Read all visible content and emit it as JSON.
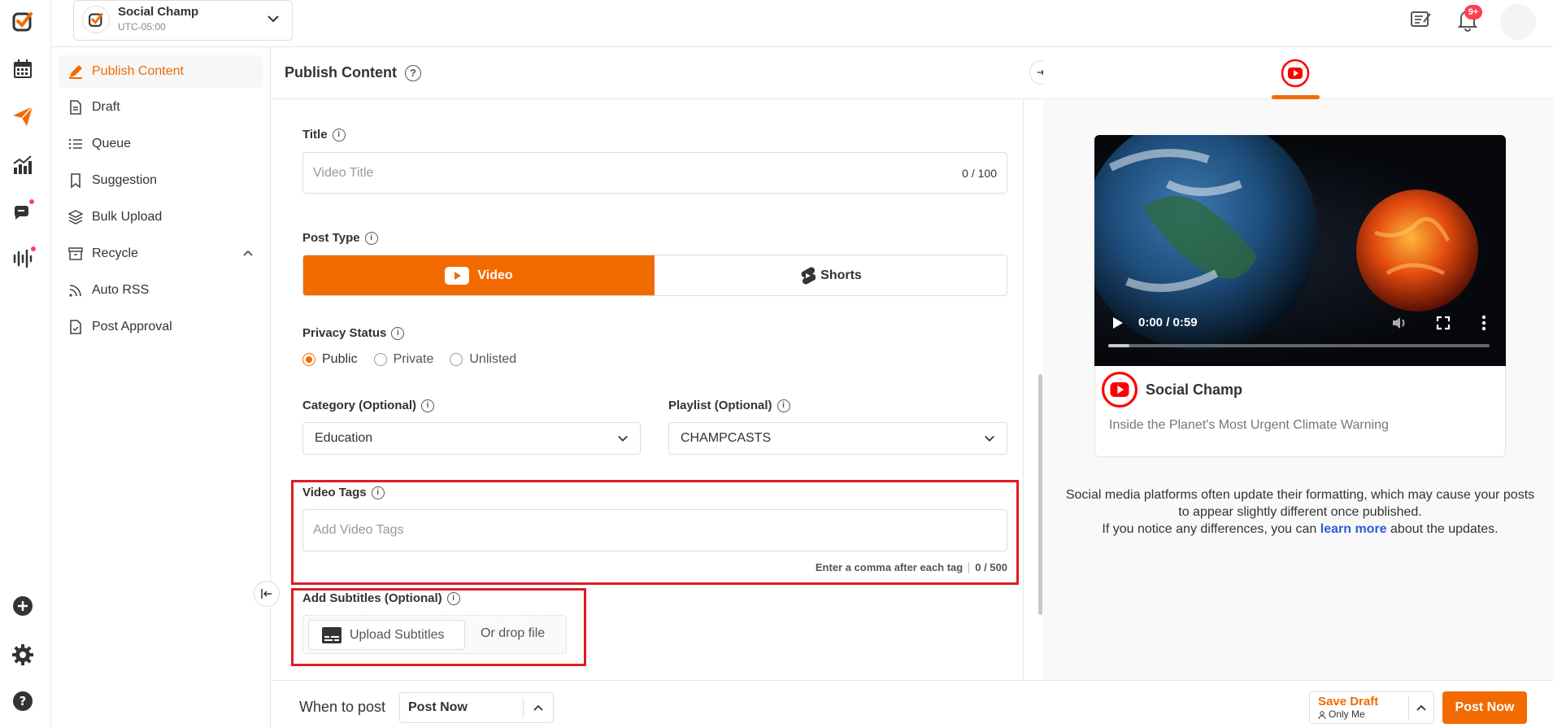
{
  "account": {
    "name": "Social Champ",
    "timezone": "UTC-05:00"
  },
  "notifications": {
    "badge": "9+"
  },
  "nav": {
    "items": [
      {
        "label": "Publish Content"
      },
      {
        "label": "Draft"
      },
      {
        "label": "Queue"
      },
      {
        "label": "Suggestion"
      },
      {
        "label": "Bulk Upload"
      },
      {
        "label": "Recycle"
      },
      {
        "label": "Auto RSS"
      },
      {
        "label": "Post Approval"
      }
    ]
  },
  "header": {
    "title": "Publish Content",
    "help_icon": "?"
  },
  "form": {
    "title": {
      "label": "Title",
      "placeholder": "Video Title",
      "counter": "0 / 100"
    },
    "post_type": {
      "label": "Post Type",
      "options": [
        "Video",
        "Shorts"
      ],
      "selected": "Video"
    },
    "privacy": {
      "label": "Privacy Status",
      "options": [
        "Public",
        "Private",
        "Unlisted"
      ],
      "selected": "Public"
    },
    "category": {
      "label": "Category (Optional)",
      "value": "Education"
    },
    "playlist": {
      "label": "Playlist (Optional)",
      "value": "CHAMPCASTS"
    },
    "tags": {
      "label": "Video Tags",
      "placeholder": "Add Video Tags",
      "hint": "Enter a comma after each tag",
      "counter": "0 / 500"
    },
    "subtitles": {
      "label": "Add Subtitles (Optional)",
      "upload_label": "Upload Subtitles",
      "drop_label": "Or drop file"
    }
  },
  "preview": {
    "video_time": "0:00 / 0:59",
    "channel_name": "Social Champ",
    "video_title": "Inside the Planet's Most Urgent Climate Warning",
    "notice_line1": "Social media platforms often update their formatting, which may cause your posts to appear slightly different once published.",
    "notice_line2_prefix": "If you notice any differences, you can",
    "notice_link": "learn more",
    "notice_line2_suffix": "about the updates."
  },
  "footer": {
    "when_label": "When to post",
    "when_value": "Post Now",
    "save_draft": "Save Draft",
    "visibility": "Only Me",
    "post_now": "Post Now"
  },
  "colors": {
    "accent": "#f26b00",
    "youtube": "#ff0000",
    "highlight": "#e01b24",
    "link": "#2f5bd8"
  }
}
